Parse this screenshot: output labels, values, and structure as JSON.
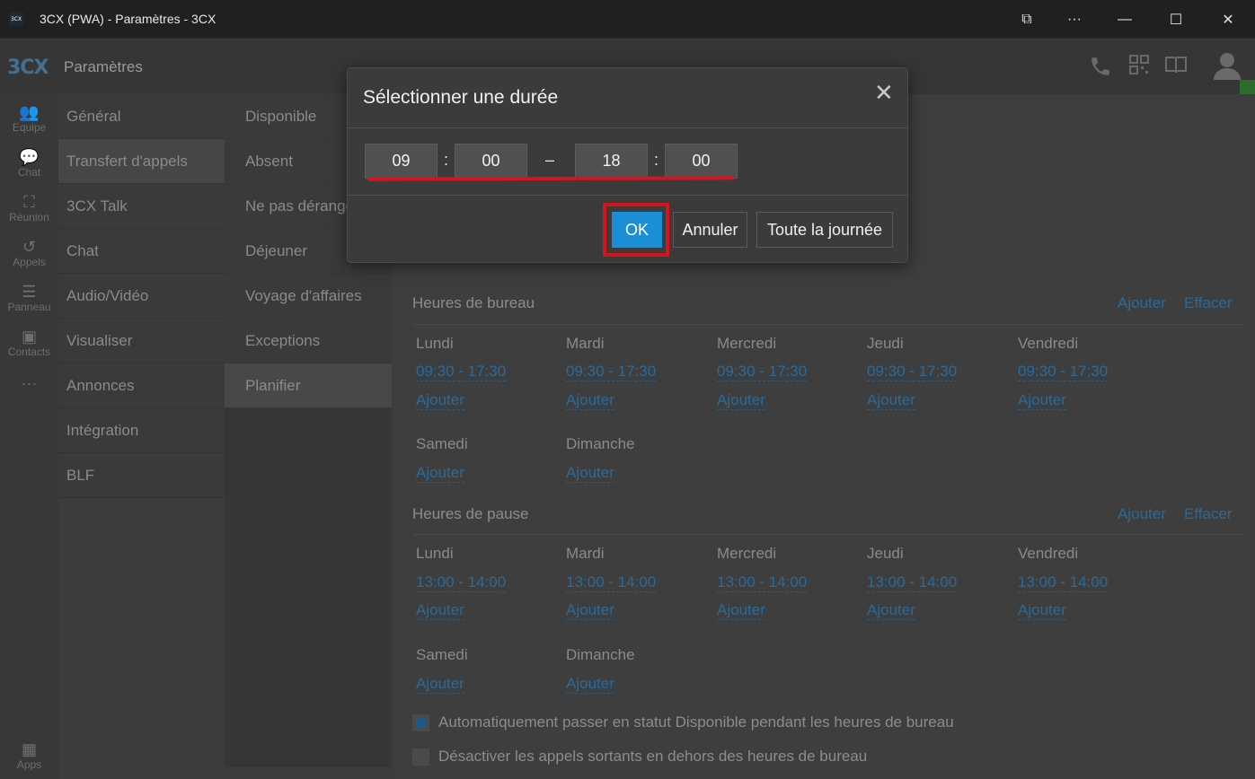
{
  "window": {
    "title": "3CX (PWA) - Paramètres - 3CX",
    "app_icon_text": "3CX",
    "controls": {
      "cast": "⧉",
      "more": "···",
      "minimize": "—",
      "maximize": "☐",
      "close": "✕"
    }
  },
  "header": {
    "logo": "3CX",
    "title": "Paramètres",
    "icons": [
      "phone-icon",
      "qr-code-icon",
      "book-icon",
      "user-avatar-icon"
    ],
    "status_color": "#2e6b2e"
  },
  "rail": {
    "items": [
      {
        "label": "Equipe",
        "icon": "team-icon"
      },
      {
        "label": "Chat",
        "icon": "chat-icon"
      },
      {
        "label": "Réunion",
        "icon": "meeting-icon"
      },
      {
        "label": "Appels",
        "icon": "history-icon"
      },
      {
        "label": "Panneau",
        "icon": "panel-icon"
      },
      {
        "label": "Contacts",
        "icon": "contacts-icon"
      },
      {
        "label": "···",
        "icon": "more-icon"
      }
    ],
    "apps": {
      "label": "Apps",
      "icon": "apps-icon"
    }
  },
  "settings_menu": {
    "items": [
      "Général",
      "Transfert d'appels",
      "3CX Talk",
      "Chat",
      "Audio/Vidéo",
      "Visualiser",
      "Annonces",
      "Intégration",
      "BLF"
    ],
    "selected": "Transfert d'appels"
  },
  "status_menu": {
    "items": [
      "Disponible",
      "Absent",
      "Ne pas déranger",
      "Déjeuner",
      "Voyage d'affaires",
      "Exceptions",
      "Planifier"
    ],
    "selected": "Planifier"
  },
  "office_hours": {
    "title": "Heures de bureau",
    "add_label": "Ajouter",
    "clear_label": "Effacer",
    "days": [
      {
        "day": "Lundi",
        "time": "09:30 - 17:30",
        "add": "Ajouter"
      },
      {
        "day": "Mardi",
        "time": "09:30 - 17:30",
        "add": "Ajouter"
      },
      {
        "day": "Mercredi",
        "time": "09:30 - 17:30",
        "add": "Ajouter"
      },
      {
        "day": "Jeudi",
        "time": "09:30 - 17:30",
        "add": "Ajouter"
      },
      {
        "day": "Vendredi",
        "time": "09:30 - 17:30",
        "add": "Ajouter"
      },
      {
        "day": "Samedi",
        "add": "Ajouter"
      },
      {
        "day": "Dimanche",
        "add": "Ajouter"
      }
    ]
  },
  "break_hours": {
    "title": "Heures de pause",
    "add_label": "Ajouter",
    "clear_label": "Effacer",
    "days": [
      {
        "day": "Lundi",
        "time": "13:00 - 14:00",
        "add": "Ajouter"
      },
      {
        "day": "Mardi",
        "time": "13:00 - 14:00",
        "add": "Ajouter"
      },
      {
        "day": "Mercredi",
        "time": "13:00 - 14:00",
        "add": "Ajouter"
      },
      {
        "day": "Jeudi",
        "time": "13:00 - 14:00",
        "add": "Ajouter"
      },
      {
        "day": "Vendredi",
        "time": "13:00 - 14:00",
        "add": "Ajouter"
      },
      {
        "day": "Samedi",
        "add": "Ajouter"
      },
      {
        "day": "Dimanche",
        "add": "Ajouter"
      }
    ]
  },
  "options": {
    "auto_available": {
      "label": "Automatiquement passer en statut Disponible pendant les heures de bureau",
      "checked": true
    },
    "disable_outgoing": {
      "label": "Désactiver les appels sortants en dehors des heures de bureau",
      "checked": false
    }
  },
  "dialog": {
    "title": "Sélectionner une durée",
    "close_icon": "✕",
    "start_hour": "09",
    "start_minute": "00",
    "end_hour": "18",
    "end_minute": "00",
    "colon": ":",
    "dash": "–",
    "ok_label": "OK",
    "cancel_label": "Annuler",
    "all_day_label": "Toute la journée",
    "accent_color": "#1a8fd6",
    "highlight_color": "#d4141e"
  }
}
